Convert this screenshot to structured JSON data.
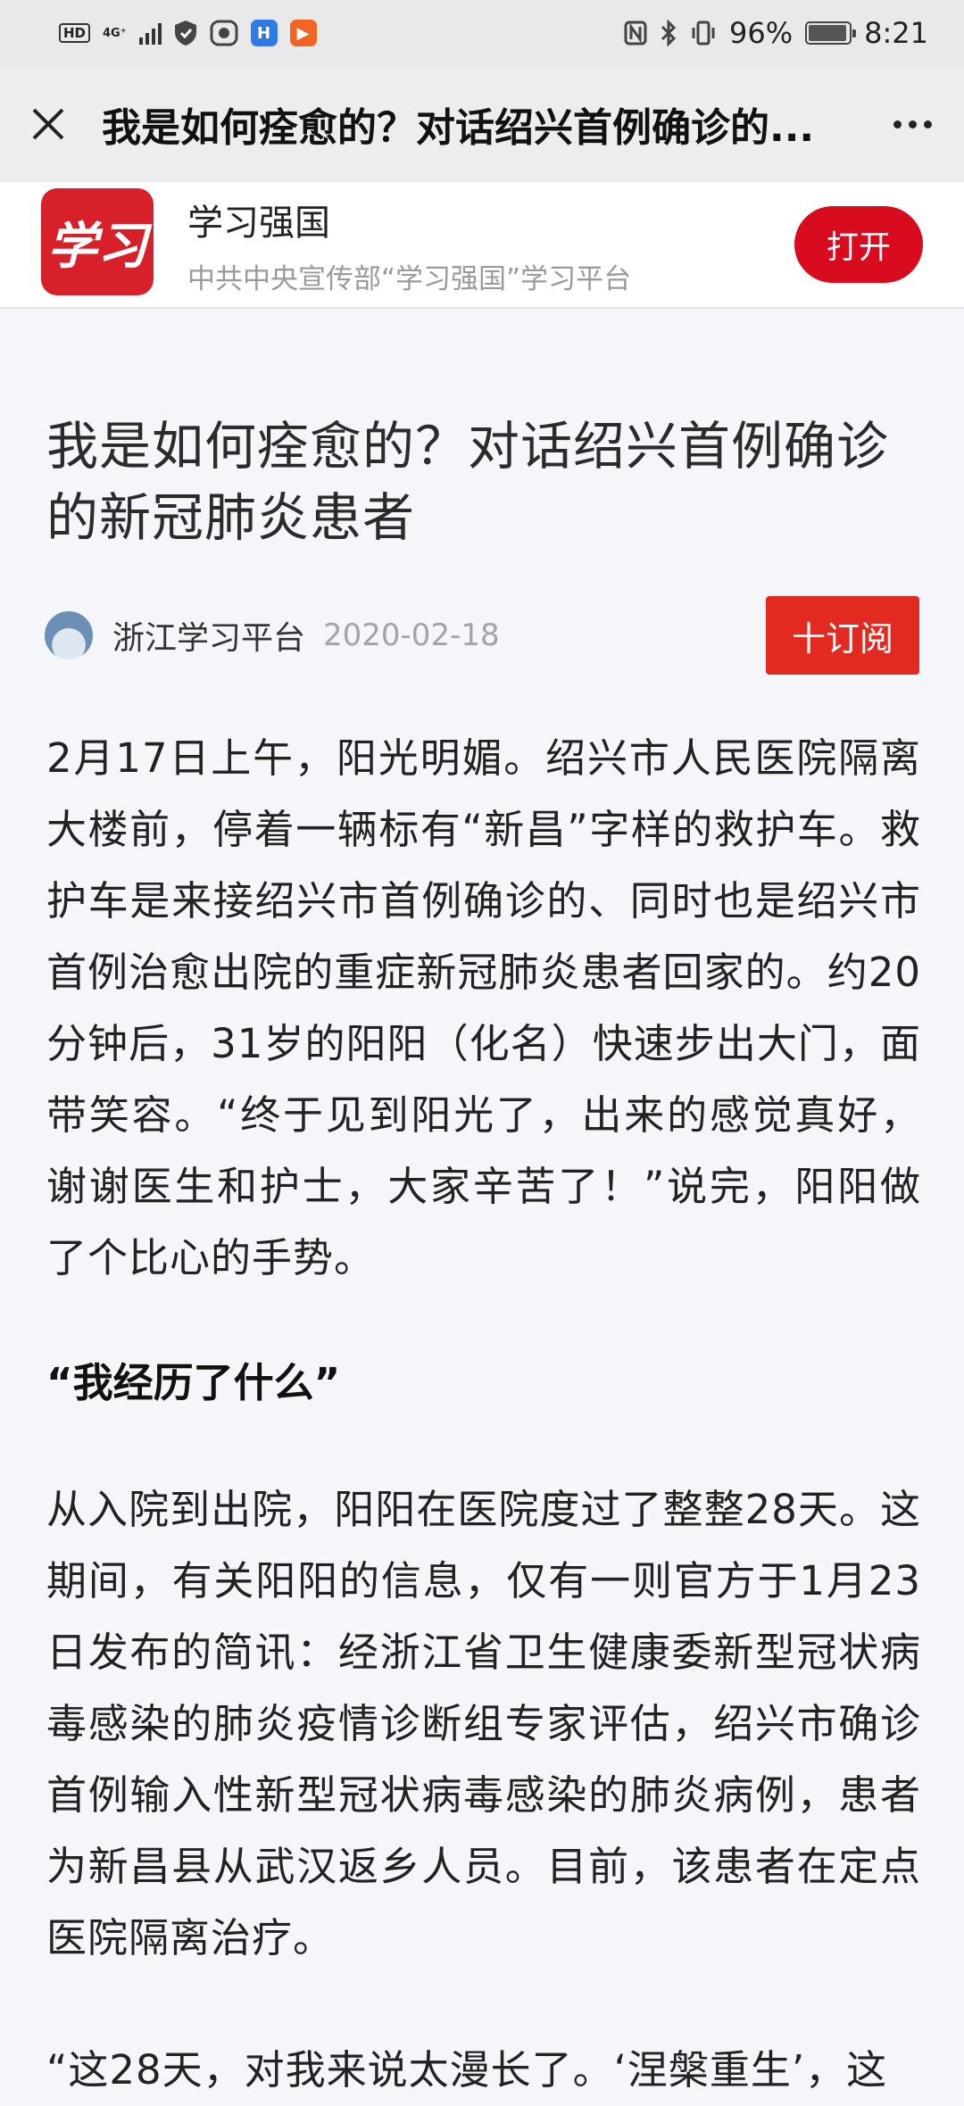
{
  "status_bar": {
    "left_hd": "HD",
    "network": "4G⁺",
    "battery_percent": "96%",
    "time": "8:21",
    "icons": [
      "hd-icon",
      "signal-icon",
      "shield-icon",
      "app-icon",
      "app-icon-blue",
      "app-icon-orange",
      "nfc-icon",
      "bluetooth-icon",
      "vibrate-icon",
      "battery-icon"
    ]
  },
  "title_bar": {
    "title": "我是如何痊愈的？对话绍兴首例确诊的...",
    "close_icon": "close-icon",
    "more_icon": "more-icon"
  },
  "app_banner": {
    "logo_text": "学习",
    "name": "学习强国",
    "description": "中共中央宣传部“学习强国”学习平台",
    "open_label": "打开"
  },
  "article": {
    "title": "我是如何痊愈的？对话绍兴首例确诊的新冠肺炎患者",
    "author": "浙江学习平台",
    "date": "2020-02-18",
    "subscribe_label": "十订阅",
    "paragraph_1": "2月17日上午，阳光明媚。绍兴市人民医院隔离大楼前，停着一辆标有“新昌”字样的救护车。救护车是来接绍兴市首例确诊的、同时也是绍兴市首例治愈出院的重症新冠肺炎患者回家的。约20分钟后，31岁的阳阳（化名）快速步出大门，面带笑容。“终于见到阳光了，出来的感觉真好，谢谢医生和护士，大家辛苦了！”说完，阳阳做了个比心的手势。",
    "heading_1": "“我经历了什么”",
    "paragraph_2": "从入院到出院，阳阳在医院度过了整整28天。这期间，有关阳阳的信息，仅有一则官方于1月23日发布的简讯：经浙江省卫生健康委新型冠状病毒感染的肺炎疫情诊断组专家评估，绍兴市确诊首例输入性新型冠状病毒感染的肺炎病例，患者为新昌县从武汉返乡人员。目前，该患者在定点医院隔离治疗。",
    "paragraph_3": "“这28天，对我来说太漫长了。‘涅槃重生’，这"
  }
}
